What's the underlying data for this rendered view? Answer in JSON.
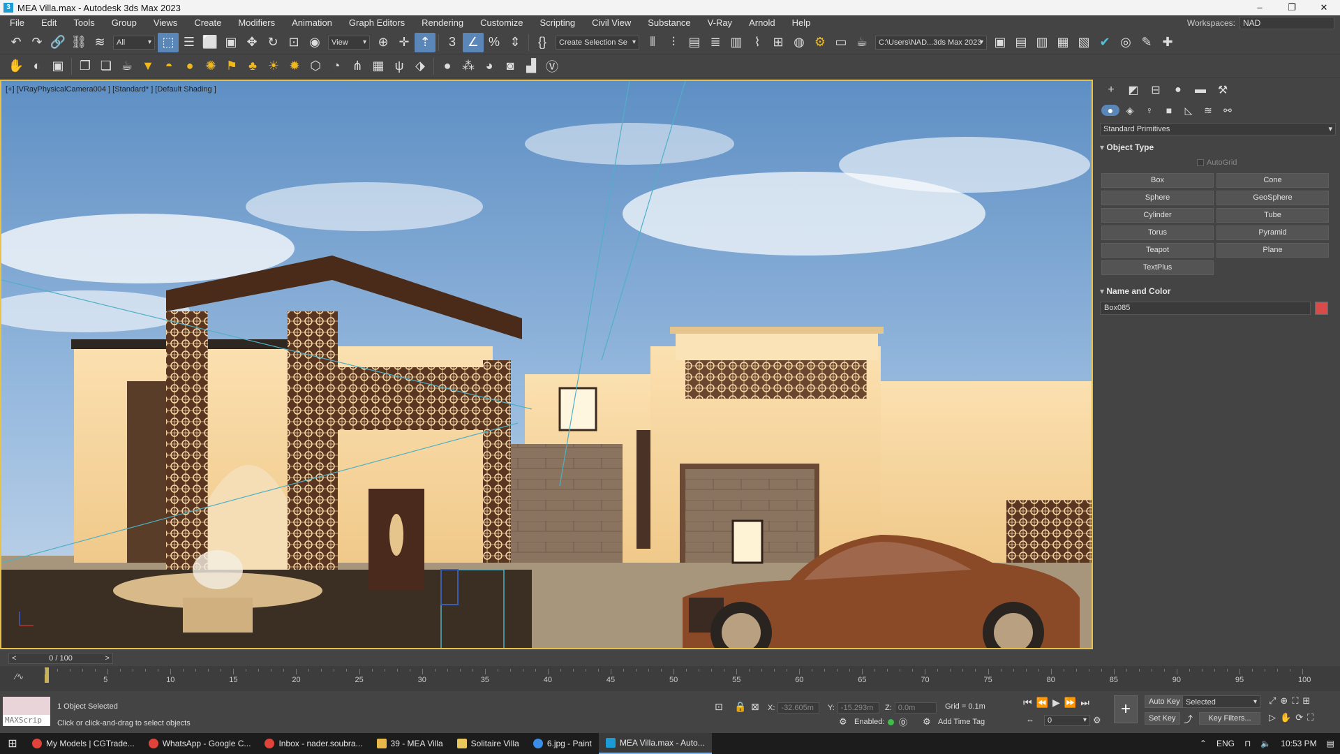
{
  "window": {
    "title": "MEA Villa.max - Autodesk 3ds Max 2023",
    "controls": [
      "–",
      "❐",
      "✕"
    ]
  },
  "menu": [
    "File",
    "Edit",
    "Tools",
    "Group",
    "Views",
    "Create",
    "Modifiers",
    "Animation",
    "Graph Editors",
    "Rendering",
    "Customize",
    "Scripting",
    "Civil View",
    "Substance",
    "V-Ray",
    "Arnold",
    "Help"
  ],
  "workspace": {
    "label": "Workspaces:",
    "value": "NAD"
  },
  "toolbar": {
    "selection_filter": "All",
    "ref_coord": "View",
    "named_selection": "Create Selection Se",
    "project_path": "C:\\Users\\NAD...3ds Max 2023"
  },
  "viewport": {
    "label": "[+] [VRayPhysicalCamera004 ] [Standard* ] [Default Shading ]"
  },
  "command_panel": {
    "category": "Standard Primitives",
    "object_type_header": "Object Type",
    "autogrid": "AutoGrid",
    "primitives": [
      "Box",
      "Cone",
      "Sphere",
      "GeoSphere",
      "Cylinder",
      "Tube",
      "Torus",
      "Pyramid",
      "Teapot",
      "Plane",
      "TextPlus"
    ],
    "name_color_header": "Name and Color",
    "object_name": "Box085",
    "object_color": "#d94a4a"
  },
  "timeline": {
    "frame_display": "0 / 100",
    "ticks": [
      "5",
      "10",
      "15",
      "20",
      "25",
      "30",
      "35",
      "40",
      "45",
      "50",
      "55",
      "60",
      "65",
      "70",
      "75",
      "80",
      "85",
      "90",
      "95",
      "100"
    ]
  },
  "status": {
    "maxscript_label": "MAXScrip",
    "selection_info": "1 Object Selected",
    "prompt": "Click or click-and-drag to select objects",
    "x_label": "X:",
    "x_value": "-32.605m",
    "y_label": "Y:",
    "y_value": "-15.293m",
    "z_label": "Z:",
    "z_value": "0.0m",
    "grid": "Grid = 0.1m",
    "enabled_label": "Enabled:",
    "add_time_tag": "Add Time Tag",
    "auto_key": "Auto Key",
    "selected_dropdown": "Selected",
    "set_key": "Set Key",
    "key_filters": "Key Filters...",
    "frame_field": "0"
  },
  "taskbar": {
    "items": [
      {
        "label": "My Models | CGTrade...",
        "color": "#e0433a"
      },
      {
        "label": "WhatsApp - Google C...",
        "color": "#e0433a"
      },
      {
        "label": "Inbox - nader.soubra...",
        "color": "#e0433a"
      },
      {
        "label": "39 - MEA Villa",
        "color": "#e8b84a"
      },
      {
        "label": "Solitaire Villa",
        "color": "#e8c85a"
      },
      {
        "label": "6.jpg - Paint",
        "color": "#3a8ee6"
      },
      {
        "label": "MEA Villa.max - Auto...",
        "color": "#1b9cd6"
      }
    ],
    "language": "ENG",
    "time": "10:53 PM"
  }
}
